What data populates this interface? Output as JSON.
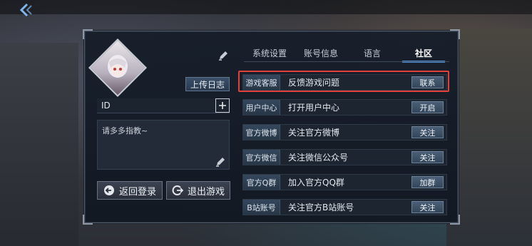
{
  "tabs": [
    {
      "label": "系统设置"
    },
    {
      "label": "账号信息"
    },
    {
      "label": "语言"
    },
    {
      "label": "社区"
    }
  ],
  "profile": {
    "upload_log_label": "上传日志",
    "id_label": "ID",
    "signature": "请多多指教~"
  },
  "actions": {
    "back_login_label": "返回登录",
    "exit_game_label": "退出游戏"
  },
  "community_rows": [
    {
      "label": "游戏客服",
      "desc": "反馈游戏问题",
      "button": "联系"
    },
    {
      "label": "用户中心",
      "desc": "打开用户中心",
      "button": "开启"
    },
    {
      "label": "官方微博",
      "desc": "关注官方微博",
      "button": "关注"
    },
    {
      "label": "官方微信",
      "desc": "关注微信公众号",
      "button": "关注"
    },
    {
      "label": "官方Q群",
      "desc": "加入官方QQ群",
      "button": "加群"
    },
    {
      "label": "B站账号",
      "desc": "关注官方B站账号",
      "button": "关注"
    }
  ],
  "colors": {
    "accent": "#4e8fd6",
    "highlight": "#e0413a"
  }
}
